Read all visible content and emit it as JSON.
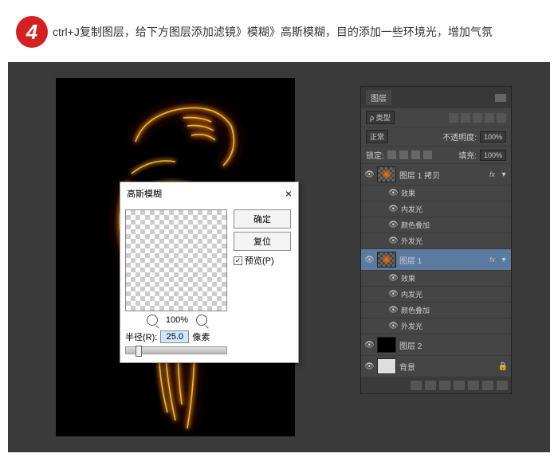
{
  "step": {
    "number": "4",
    "text": "ctrl+J复制图层，给下方图层添加滤镜》模糊》高斯模糊，目的添加一些环境光，增加气氛"
  },
  "dialog": {
    "title": "高斯模糊",
    "ok": "确定",
    "reset": "复位",
    "preview_label": "预览(P)",
    "zoom": "100%",
    "radius_label": "半径(R):",
    "radius_value": "25.0",
    "radius_unit": "像素"
  },
  "panel": {
    "tab": "图层",
    "kind": "ρ 类型",
    "blend": "正常",
    "opacity_label": "不透明度:",
    "opacity": "100%",
    "lock_label": "锁定:",
    "fill_label": "填充:",
    "fill": "100%",
    "layers": [
      {
        "name": "图层 1 拷贝",
        "fx": true,
        "effects": [
          "效果",
          "内发光",
          "颜色叠加",
          "外发光"
        ]
      },
      {
        "name": "图层 1",
        "fx": true,
        "selected": true,
        "effects": [
          "效果",
          "内发光",
          "颜色叠加",
          "外发光"
        ]
      },
      {
        "name": "图层 2"
      },
      {
        "name": "背景",
        "locked": true
      }
    ]
  }
}
